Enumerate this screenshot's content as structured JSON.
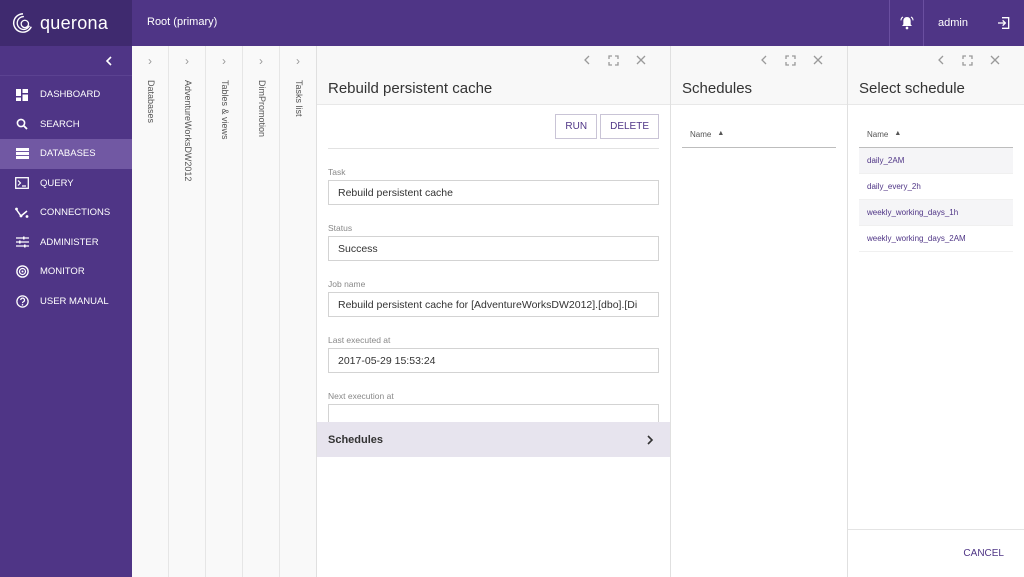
{
  "app": {
    "name": "querona",
    "breadcrumb": "Root (primary)"
  },
  "header": {
    "user": "admin",
    "notifications_icon": "bell-icon",
    "logout_icon": "logout-icon"
  },
  "sidebar": {
    "collapse_icon": "chevron-left-icon",
    "items": [
      {
        "label": "DASHBOARD",
        "icon": "dashboard-icon",
        "active": false
      },
      {
        "label": "SEARCH",
        "icon": "search-icon",
        "active": false
      },
      {
        "label": "DATABASES",
        "icon": "databases-icon",
        "active": true
      },
      {
        "label": "QUERY",
        "icon": "terminal-icon",
        "active": false
      },
      {
        "label": "CONNECTIONS",
        "icon": "connections-icon",
        "active": false
      },
      {
        "label": "ADMINISTER",
        "icon": "sliders-icon",
        "active": false
      },
      {
        "label": "MONITOR",
        "icon": "monitor-icon",
        "active": false
      },
      {
        "label": "USER MANUAL",
        "icon": "help-icon",
        "active": false
      }
    ]
  },
  "collapsed_panels": [
    {
      "label": "Databases"
    },
    {
      "label": "AdventureWorksDW2012"
    },
    {
      "label": "Tables & views"
    },
    {
      "label": "DimPromotion"
    },
    {
      "label": "Tasks list"
    }
  ],
  "task_panel": {
    "title": "Rebuild persistent cache",
    "run_label": "RUN",
    "delete_label": "DELETE",
    "fields": [
      {
        "label": "Task",
        "value": "Rebuild persistent cache"
      },
      {
        "label": "Status",
        "value": "Success"
      },
      {
        "label": "Job name",
        "value": "Rebuild persistent cache for [AdventureWorksDW2012].[dbo].[Di"
      },
      {
        "label": "Last executed at",
        "value": "2017-05-29 15:53:24"
      },
      {
        "label": "Next execution at",
        "value": ""
      }
    ],
    "schedules_label": "Schedules"
  },
  "schedules_panel": {
    "title": "Schedules",
    "column": "Name",
    "rows": []
  },
  "select_schedule_panel": {
    "title": "Select schedule",
    "column": "Name",
    "rows": [
      "daily_2AM",
      "daily_every_2h",
      "weekly_working_days_1h",
      "weekly_working_days_2AM"
    ],
    "cancel_label": "CANCEL"
  }
}
